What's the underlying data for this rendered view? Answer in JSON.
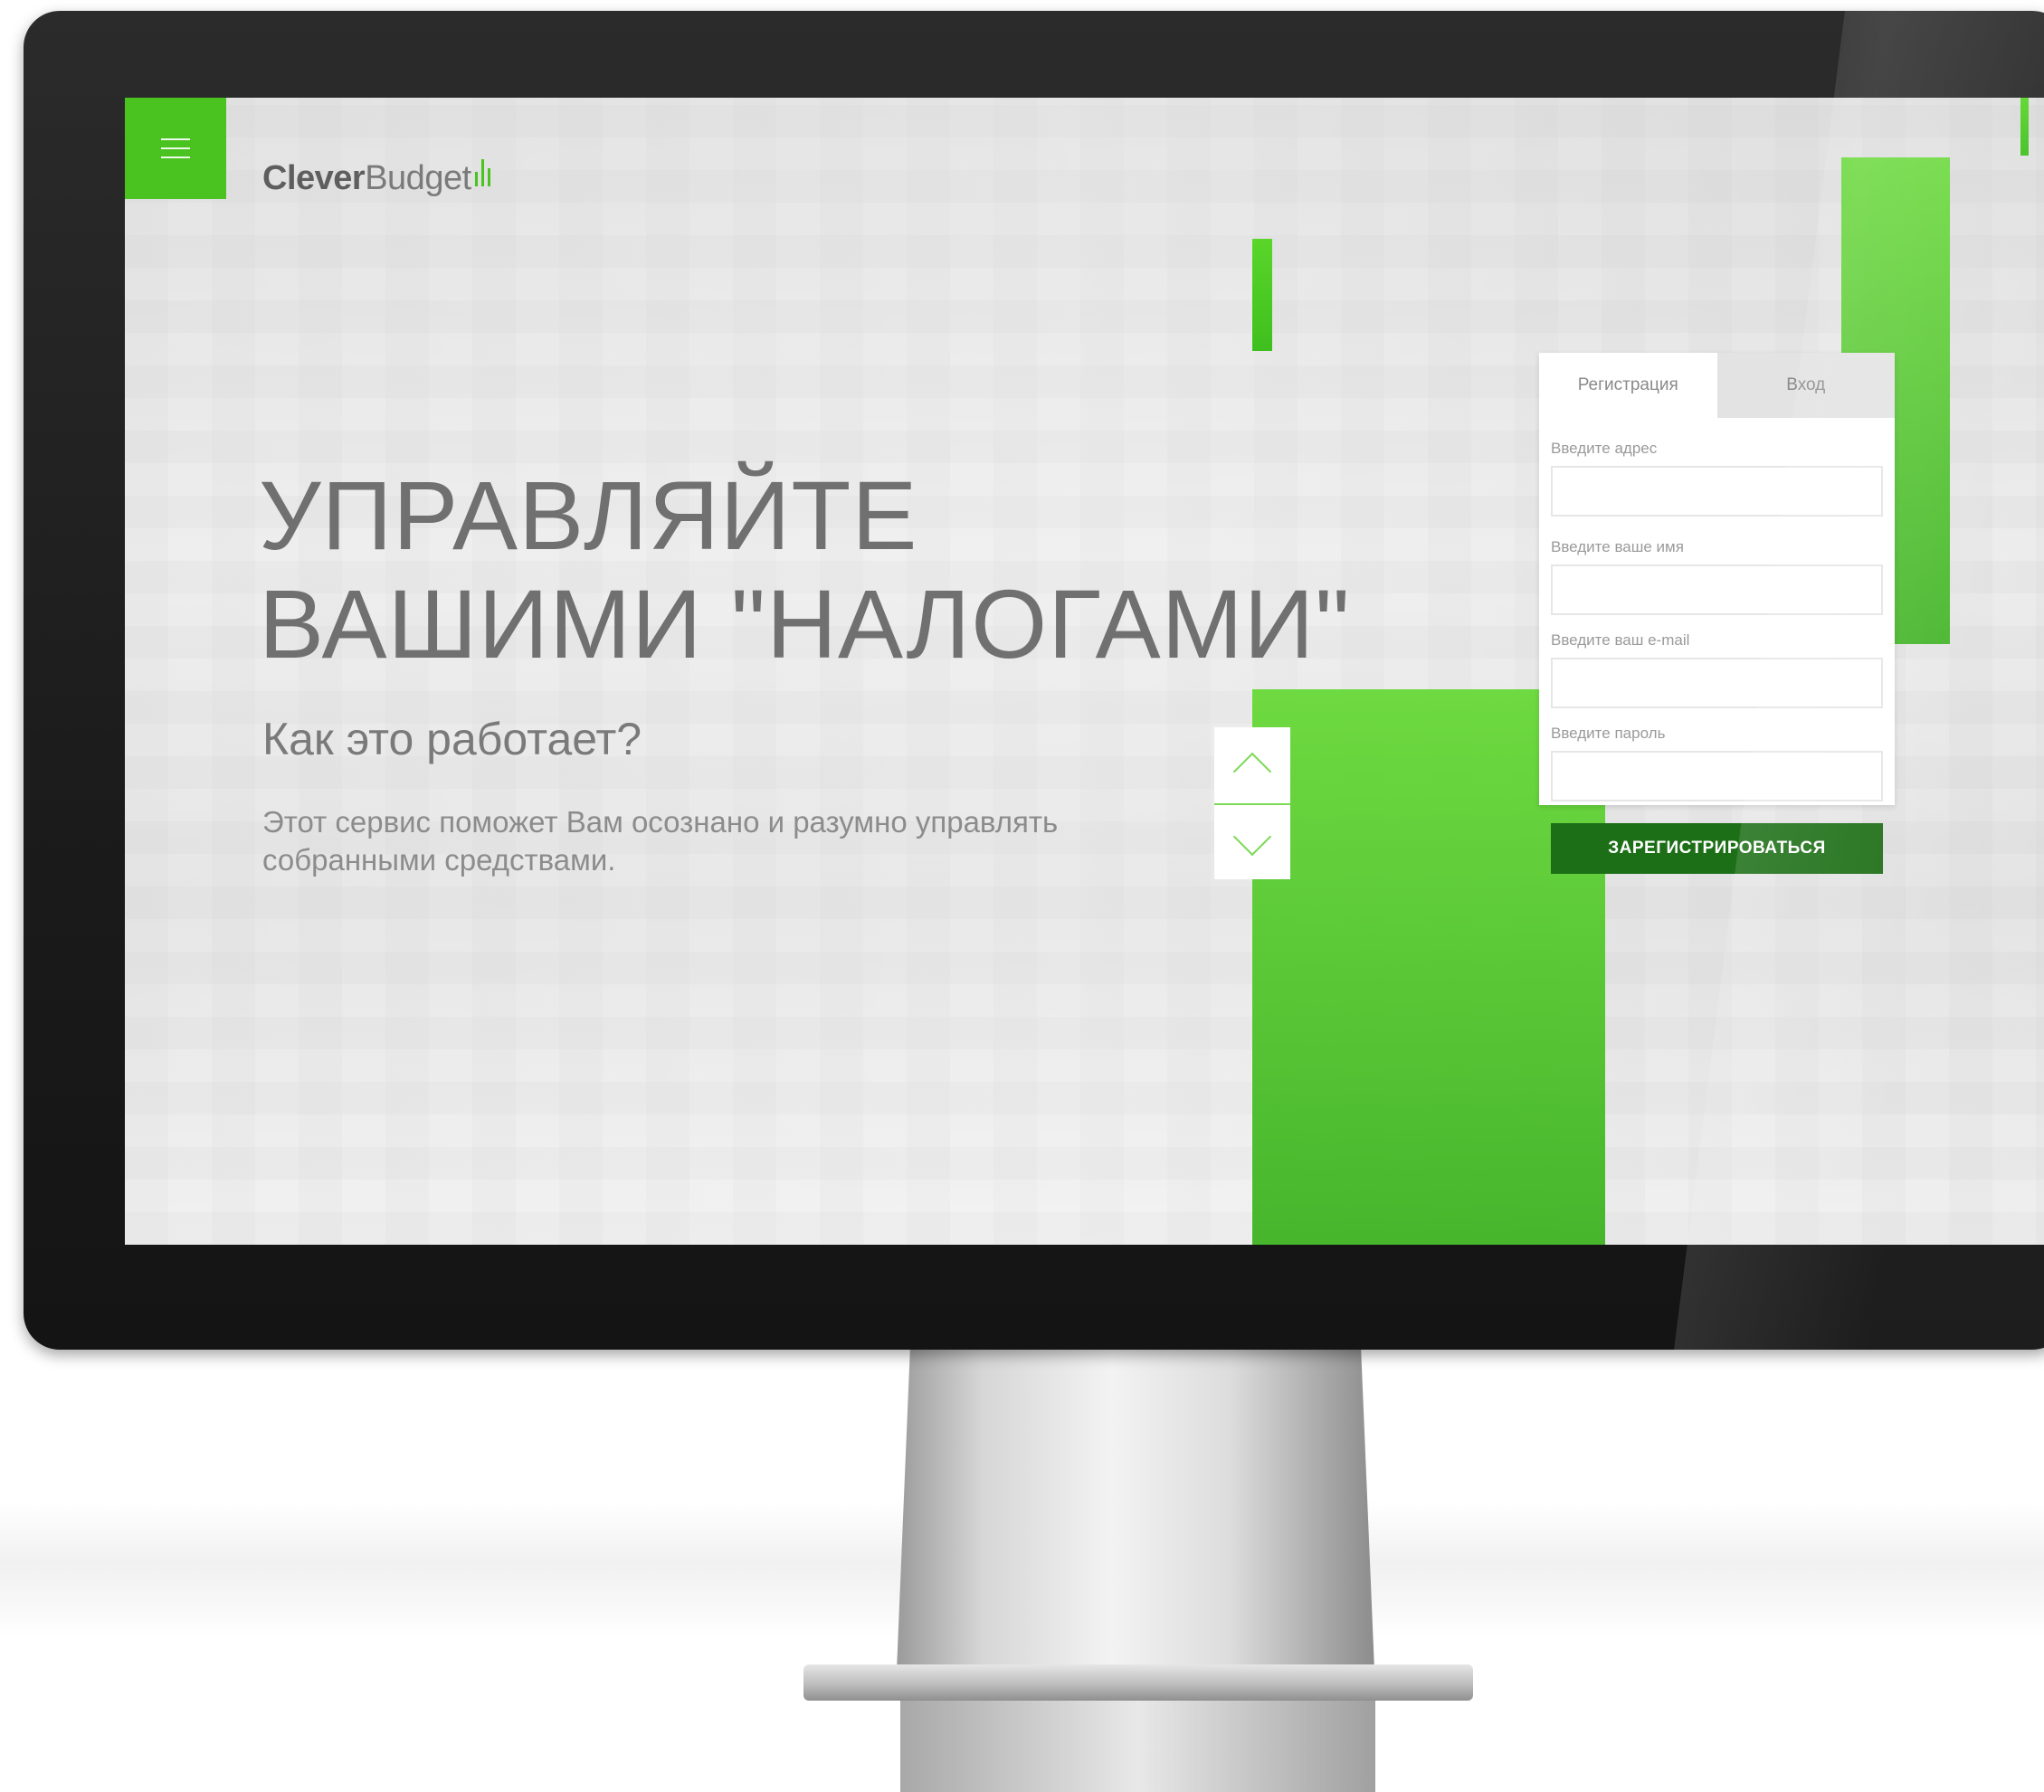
{
  "brand": {
    "name_bold": "Clever",
    "name_light": "Budget",
    "accent_color": "#4ac21f",
    "dark_green": "#1d6f17"
  },
  "header": {
    "menu_icon": "hamburger-menu-icon"
  },
  "hero": {
    "headline_line1": "УПРАВЛЯЙТЕ",
    "headline_line2": "ВАШИМИ \"НАЛОГАМИ\"",
    "subtitle": "Как это работает?",
    "description_line1": "Этот сервис поможет Вам осознано и разумно управлять",
    "description_line2": "собранными средствами."
  },
  "slider": {
    "up_icon": "chevron-up-icon",
    "down_icon": "chevron-down-icon"
  },
  "auth_form": {
    "tabs": [
      {
        "label": "Регистрация",
        "active": true
      },
      {
        "label": "Вход",
        "active": false
      }
    ],
    "fields": [
      {
        "label": "Введите адрес",
        "value": ""
      },
      {
        "label": "Введите ваше имя",
        "value": ""
      },
      {
        "label": "Введите ваш e-mail",
        "value": ""
      },
      {
        "label": "Введите пароль",
        "value": ""
      }
    ],
    "submit_label": "ЗАРЕГИСТРИРОВАТЬСЯ"
  }
}
